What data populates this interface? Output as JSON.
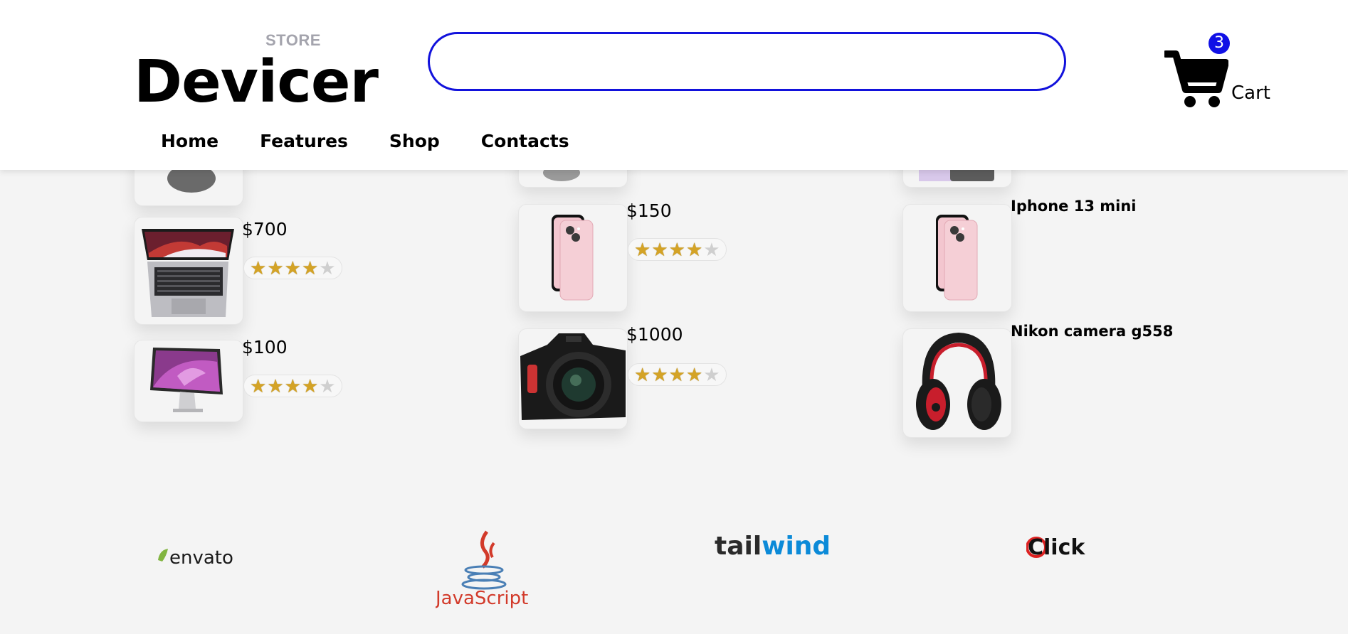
{
  "header": {
    "store_label": "STORE",
    "brand": "Devicer",
    "search": {
      "value": "",
      "placeholder": ""
    },
    "cart": {
      "count": "3",
      "label": "Cart"
    }
  },
  "nav": [
    "Home",
    "Features",
    "Shop",
    "Contacts"
  ],
  "products": {
    "col1": [
      {
        "price": "$700",
        "rating": 4,
        "image": "laptop-image"
      },
      {
        "price": "$100",
        "rating": 4,
        "image": "monitor-image"
      }
    ],
    "col2": [
      {
        "price": "$150",
        "rating": 4,
        "image": "iphone-image"
      },
      {
        "price": "$1000",
        "rating": 4,
        "image": "camera-image"
      }
    ],
    "col3": [
      {
        "name": "Iphone 13 mini",
        "image": "iphone-image"
      },
      {
        "name": "Nikon camera g558",
        "image": "headphones-image"
      }
    ]
  },
  "partners": [
    "envato",
    "JavaScript",
    "tailwind",
    "Click"
  ],
  "colors": {
    "accent": "#1212dc",
    "star": "#d4a326",
    "tailwind_blue": "#0b8ad8",
    "java_red": "#d23a2a"
  }
}
